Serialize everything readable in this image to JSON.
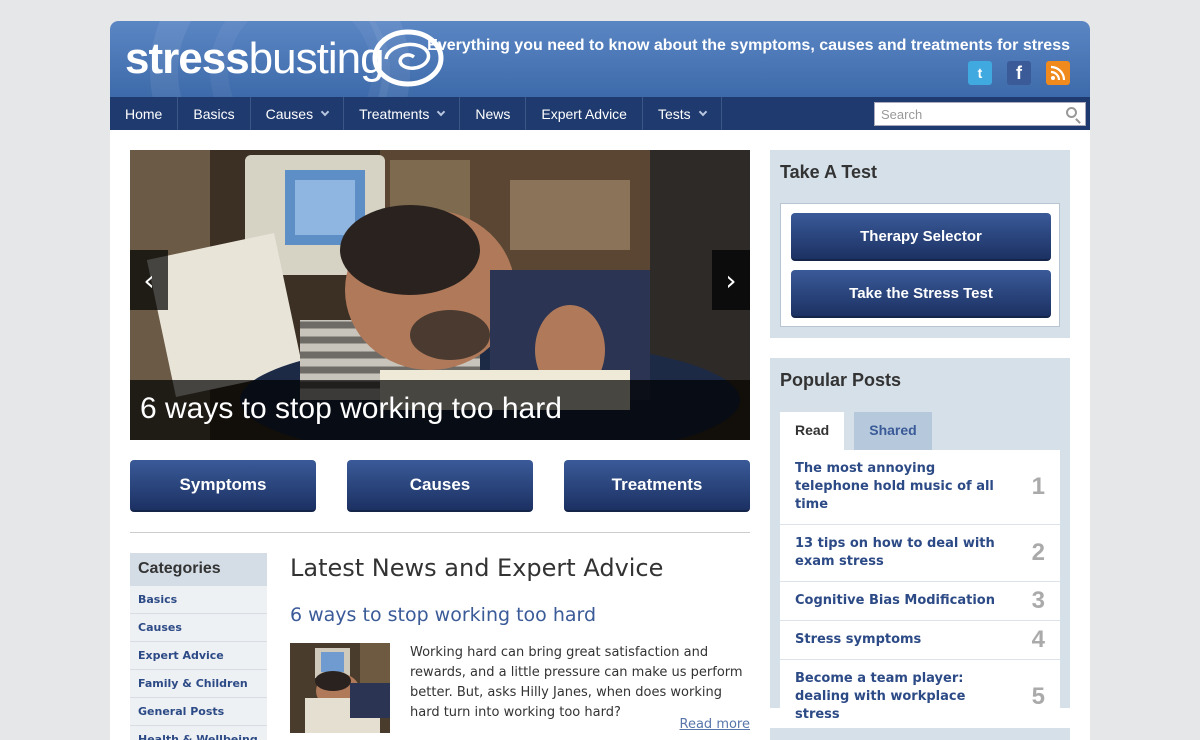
{
  "header": {
    "logo_bold": "stress",
    "logo_light": "busting",
    "tagline": "Everything you need to know about the symptoms, causes and treatments for stress",
    "social": [
      {
        "name": "twitter-icon",
        "glyph": "t"
      },
      {
        "name": "facebook-icon",
        "glyph": "f"
      },
      {
        "name": "rss-icon",
        "glyph": ""
      }
    ]
  },
  "nav": {
    "items": [
      {
        "label": "Home",
        "dropdown": false
      },
      {
        "label": "Basics",
        "dropdown": false
      },
      {
        "label": "Causes",
        "dropdown": true
      },
      {
        "label": "Treatments",
        "dropdown": true
      },
      {
        "label": "News",
        "dropdown": false
      },
      {
        "label": "Expert Advice",
        "dropdown": false
      },
      {
        "label": "Tests",
        "dropdown": true
      }
    ],
    "search_placeholder": "Search"
  },
  "hero": {
    "caption": "6 ways to stop working too hard",
    "prev": "‹",
    "next": "›"
  },
  "big_buttons": [
    "Symptoms",
    "Causes",
    "Treatments"
  ],
  "categories": {
    "title": "Categories",
    "items": [
      "Basics",
      "Causes",
      "Expert Advice",
      "Family & Children",
      "General Posts",
      "Health & Wellbeing"
    ]
  },
  "latest": {
    "title": "Latest News and Expert Advice",
    "post_title": "6 ways to stop working too hard",
    "excerpt": "Working hard can bring great satisfaction and rewards, and a little pressure can make us perform better. But, asks Hilly Janes, when does working hard turn into working too hard?",
    "read_more": "Read more"
  },
  "sidebar": {
    "test_title": "Take A Test",
    "test_buttons": [
      "Therapy Selector",
      "Take the Stress Test"
    ],
    "popular_title": "Popular Posts",
    "tabs": [
      "Read",
      "Shared"
    ],
    "popular": [
      {
        "title": "The most annoying telephone hold music of all time",
        "num": "1"
      },
      {
        "title": "13 tips on how to deal with exam stress",
        "num": "2"
      },
      {
        "title": "Cognitive Bias Modification",
        "num": "3"
      },
      {
        "title": "Stress symptoms",
        "num": "4"
      },
      {
        "title": "Become a team player: dealing with workplace stress",
        "num": "5"
      }
    ]
  }
}
